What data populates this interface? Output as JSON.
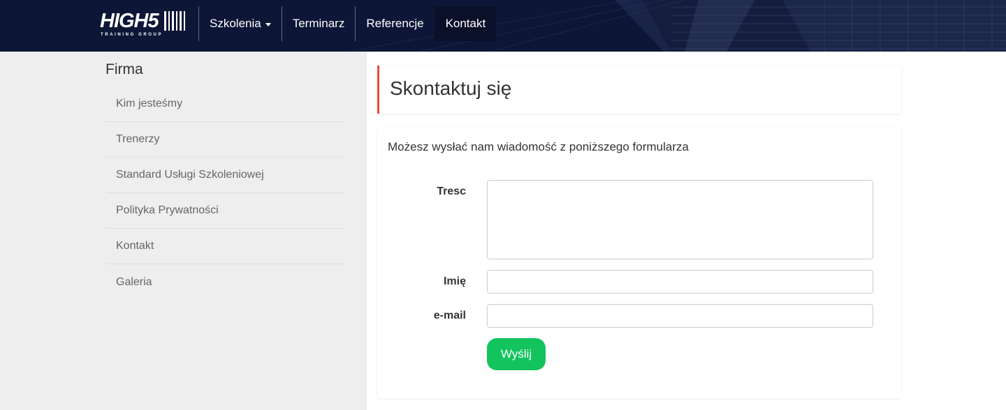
{
  "header": {
    "logo": {
      "word": "HIGH",
      "digit": "5",
      "tagline": "TRAINING GROUP"
    },
    "nav": [
      {
        "label": "Szkolenia",
        "dropdown": true
      },
      {
        "label": "Terminarz"
      },
      {
        "label": "Referencje"
      },
      {
        "label": "Kontakt",
        "active": true
      }
    ]
  },
  "sidebar": {
    "title": "Firma",
    "items": [
      {
        "label": "Kim jesteśmy"
      },
      {
        "label": "Trenerzy"
      },
      {
        "label": "Standard Usługi Szkoleniowej"
      },
      {
        "label": "Polityka Prywatności"
      },
      {
        "label": "Kontakt"
      },
      {
        "label": "Galeria"
      }
    ]
  },
  "main": {
    "heading": "Skontaktuj się",
    "intro": "Możesz wysłać nam wiadomość z poniższego formularza",
    "form": {
      "message_label": "Tresc",
      "message_value": "",
      "name_label": "Imię",
      "name_value": "",
      "email_label": "e-mail",
      "email_value": "",
      "submit_label": "Wyślij"
    }
  },
  "colors": {
    "header_bg": "#0d1636",
    "active_nav_bg": "#0a1029",
    "accent_border": "#e74c3c",
    "submit_bg": "#12c35e",
    "sidebar_bg": "#eeeeee"
  }
}
